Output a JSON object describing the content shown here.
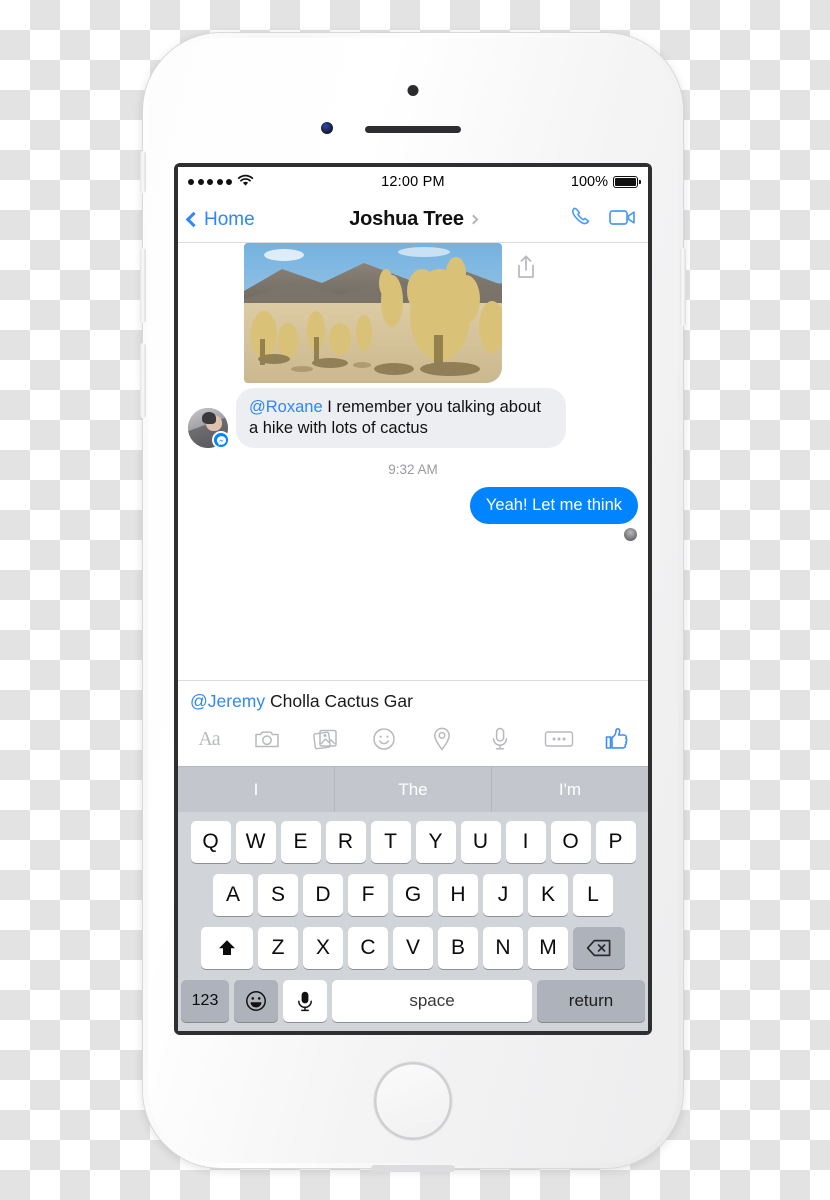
{
  "device": {
    "name": "iphone-white",
    "buttons": [
      "mute-switch",
      "volume-up",
      "volume-down",
      "power"
    ]
  },
  "status_bar": {
    "signal_dots": 5,
    "wifi_icon": "wifi-icon",
    "time": "12:00 PM",
    "battery_percent": "100%",
    "battery_level": 100
  },
  "nav": {
    "back_label": "Home",
    "title": "Joshua Tree",
    "chevron_icon": "chevron-right-icon",
    "call_icon": "phone-icon",
    "video_icon": "video-camera-icon",
    "accent_color": "#2f87f7"
  },
  "thread": {
    "photo": {
      "alt": "cholla-cactus-desert-photo",
      "share_icon": "share-icon"
    },
    "incoming": {
      "mention": "@Roxane",
      "text": " I remember you talking about a hike with lots of cactus",
      "avatar": "contact-avatar",
      "badge_icon": "messenger-badge-icon"
    },
    "timestamp": "9:32 AM",
    "outgoing": {
      "text": "Yeah! Let me think",
      "bubble_color": "#0084ff",
      "read_receipt": "read-receipt-avatar"
    }
  },
  "composer": {
    "mention": "@Jeremy",
    "text": " Cholla Cactus Gar",
    "tools": [
      {
        "name": "text-format-icon",
        "label": "Aa"
      },
      {
        "name": "camera-icon",
        "label": ""
      },
      {
        "name": "photos-icon",
        "label": ""
      },
      {
        "name": "sticker-smiley-icon",
        "label": ""
      },
      {
        "name": "location-pin-icon",
        "label": ""
      },
      {
        "name": "microphone-icon",
        "label": ""
      },
      {
        "name": "more-options-icon",
        "label": ""
      },
      {
        "name": "thumbs-up-icon",
        "label": ""
      }
    ]
  },
  "keyboard": {
    "predictions": [
      "I",
      "The",
      "I'm"
    ],
    "row1": [
      "Q",
      "W",
      "E",
      "R",
      "T",
      "Y",
      "U",
      "I",
      "O",
      "P"
    ],
    "row2": [
      "A",
      "S",
      "D",
      "F",
      "G",
      "H",
      "J",
      "K",
      "L"
    ],
    "row3": [
      "Z",
      "X",
      "C",
      "V",
      "B",
      "N",
      "M"
    ],
    "shift_icon": "shift-arrow-icon",
    "delete_icon": "backspace-icon",
    "numeric_label": "123",
    "emoji_icon": "emoji-smiley-icon",
    "dictation_icon": "microphone-icon",
    "space_label": "space",
    "return_label": "return"
  }
}
